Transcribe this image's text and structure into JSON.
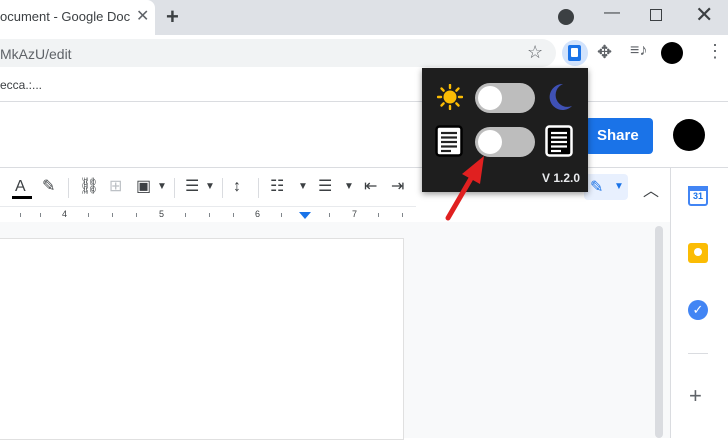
{
  "browser": {
    "tab_title": "ocument - Google Doc",
    "close_glyph": "✕",
    "newtab_glyph": "+",
    "url": "MkAzU/edit",
    "min_glyph": "—",
    "close_window_glyph": "✕"
  },
  "doc": {
    "title": "ecca.:...",
    "share_label": "Share"
  },
  "toolbar": {
    "text_color_glyph": "A",
    "ruler_numbers": [
      "4",
      "5",
      "6",
      "7"
    ]
  },
  "sidepanel": {
    "calendar_day": "31"
  },
  "extension_popup": {
    "version": "V 1.2.0",
    "theme_toggle_on": false,
    "page_toggle_on": false
  },
  "colors": {
    "accent": "#1a73e8",
    "popup_bg": "#1e1e1e",
    "sun": "#fbbc04",
    "moon": "#3f51b5",
    "arrow": "#e02020"
  }
}
